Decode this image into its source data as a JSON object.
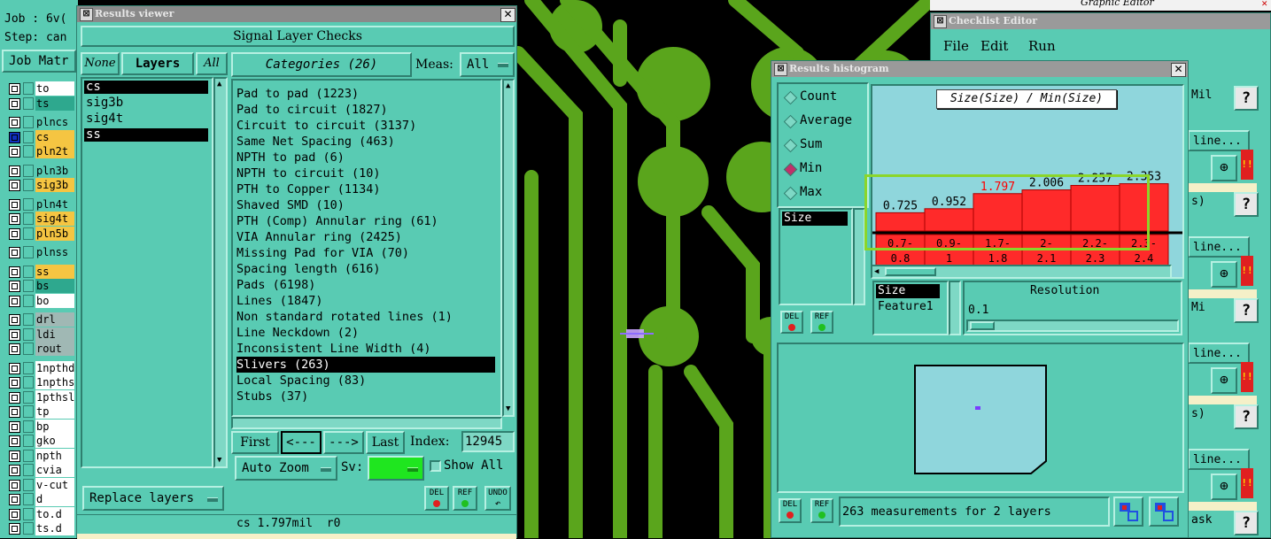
{
  "left_panel": {
    "job": "Job : 6v(",
    "step": "Step: can",
    "job_matrix": "Job Matr",
    "layers": [
      {
        "name": "to",
        "color": "#ffffff",
        "mark": false
      },
      {
        "name": "ts",
        "color": "#2ea88e",
        "mark": false
      },
      {
        "name": "plncs",
        "color": "#59cbb3",
        "mark": false
      },
      {
        "name": "cs",
        "color": "#f5c542",
        "mark": true
      },
      {
        "name": "pln2t",
        "color": "#f5c542",
        "mark": false
      },
      {
        "name": "pln3b",
        "color": "#59cbb3",
        "mark": false
      },
      {
        "name": "sig3b",
        "color": "#f5c542",
        "mark": false
      },
      {
        "name": "pln4t",
        "color": "#59cbb3",
        "mark": false
      },
      {
        "name": "sig4t",
        "color": "#f5c542",
        "mark": false
      },
      {
        "name": "pln5b",
        "color": "#f5c542",
        "mark": false
      },
      {
        "name": "plnss",
        "color": "#59cbb3",
        "mark": false
      },
      {
        "name": "ss",
        "color": "#f5c542",
        "mark": false
      },
      {
        "name": "bs",
        "color": "#2ea88e",
        "mark": false
      },
      {
        "name": "bo",
        "color": "#ffffff",
        "mark": false
      },
      {
        "name": "drl",
        "color": "#a0b8b4",
        "mark": false
      },
      {
        "name": "ldi",
        "color": "#a0b8b4",
        "mark": false
      },
      {
        "name": "rout",
        "color": "#a0b8b4",
        "mark": false
      },
      {
        "name": "1npthd",
        "color": "#ffffff",
        "mark": false
      },
      {
        "name": "1npths",
        "color": "#ffffff",
        "mark": false
      },
      {
        "name": "1pthsl",
        "color": "#ffffff",
        "mark": false
      },
      {
        "name": "tp",
        "color": "#ffffff",
        "mark": false
      },
      {
        "name": "bp",
        "color": "#ffffff",
        "mark": false
      },
      {
        "name": "gko",
        "color": "#ffffff",
        "mark": false
      },
      {
        "name": "npth",
        "color": "#ffffff",
        "mark": false
      },
      {
        "name": "cvia",
        "color": "#ffffff",
        "mark": false
      },
      {
        "name": "v-cut",
        "color": "#ffffff",
        "mark": false
      },
      {
        "name": "d",
        "color": "#ffffff",
        "mark": false
      },
      {
        "name": "to.d",
        "color": "#ffffff",
        "mark": false
      },
      {
        "name": "ts.d",
        "color": "#ffffff",
        "mark": false
      }
    ]
  },
  "results_viewer": {
    "title": "Results viewer",
    "header": "Signal Layer Checks",
    "none_label": "None",
    "layers_label": "Layers",
    "all_label": "All",
    "categories_label": "Categories (26)",
    "meas_label": "Meas:",
    "meas_value": "All",
    "layer_list": [
      "cs",
      "sig3b",
      "sig4t",
      "ss"
    ],
    "categories": [
      "Pad to pad (1223)",
      "Pad to circuit (1827)",
      "Circuit to circuit (3137)",
      "Same Net Spacing (463)",
      "NPTH to pad (6)",
      "NPTH to circuit (10)",
      "PTH to Copper (1134)",
      "Shaved SMD (10)",
      "PTH (Comp) Annular ring (61)",
      "VIA Annular ring (2425)",
      "Missing Pad for VIA (70)",
      "Spacing length (616)",
      "Pads (6198)",
      "Lines (1847)",
      "Non standard rotated lines (1)",
      "Line Neckdown (2)",
      "Inconsistent Line Width (4)",
      "Slivers (263)",
      "Local Spacing (83)",
      "Stubs (37)"
    ],
    "first_label": "First",
    "prev_label": "<---",
    "next_label": "--->",
    "last_label": "Last",
    "index_label": "Index:",
    "index_value": "12945",
    "replace_layers": "Replace layers",
    "auto_zoom": "Auto Zoom",
    "sv_label": "Sv:",
    "show_all": "Show All",
    "del_label": "DEL",
    "ref_label": "REF",
    "undo_label": "UNDO",
    "status": "cs 1.797mil  r0"
  },
  "checklist_editor": {
    "title": "Checklist Editor",
    "menu": [
      "File",
      "Edit",
      "Run"
    ],
    "top_title": "Graphic Editor",
    "side_items": [
      {
        "text": "Mil",
        "type": "field"
      },
      {
        "text": "line...",
        "type": "btn"
      },
      {
        "text": "s)",
        "type": "field"
      },
      {
        "text": "line...",
        "type": "btn"
      },
      {
        "text": "Mi",
        "type": "field"
      },
      {
        "text": "line...",
        "type": "btn"
      },
      {
        "text": "s)",
        "type": "field"
      },
      {
        "text": "line...",
        "type": "btn"
      },
      {
        "text": "ask",
        "type": "field"
      }
    ]
  },
  "histogram": {
    "title": "Results histogram",
    "modes": [
      "Count",
      "Average",
      "Sum",
      "Min",
      "Max"
    ],
    "selected_mode": "Min",
    "chart_title": "Size(Size) / Min(Size)",
    "attr_list": [
      "Size"
    ],
    "bottom_list": [
      "Size",
      "Feature1"
    ],
    "resolution_label": "Resolution",
    "resolution_value": "0.1",
    "status": "263 measurements for 2 layers",
    "del_label": "DEL",
    "ref_label": "REF",
    "highlight_color": "#8bd62a"
  },
  "chart_data": {
    "type": "bar",
    "title": "Size(Size) / Min(Size)",
    "categories": [
      "0.7-0.8",
      "0.9-1",
      "1.7-1.8",
      "2-2.1",
      "2.2-2.3",
      "2.3-2.4"
    ],
    "range_top": [
      "0.7-",
      "0.9-",
      "1.7-",
      "2-",
      "2.2-",
      "2.3-"
    ],
    "range_bottom": [
      "0.8",
      "1",
      "1.8",
      "2.1",
      "2.3",
      "2.4"
    ],
    "values": [
      0.725,
      0.952,
      1.797,
      2.006,
      2.257,
      2.353
    ],
    "value_labels": [
      "0.725",
      "0.952",
      "1.797",
      "2.006",
      "2.257",
      "2.353"
    ],
    "highlight_index": 2,
    "ylim": [
      0,
      2.5
    ]
  }
}
